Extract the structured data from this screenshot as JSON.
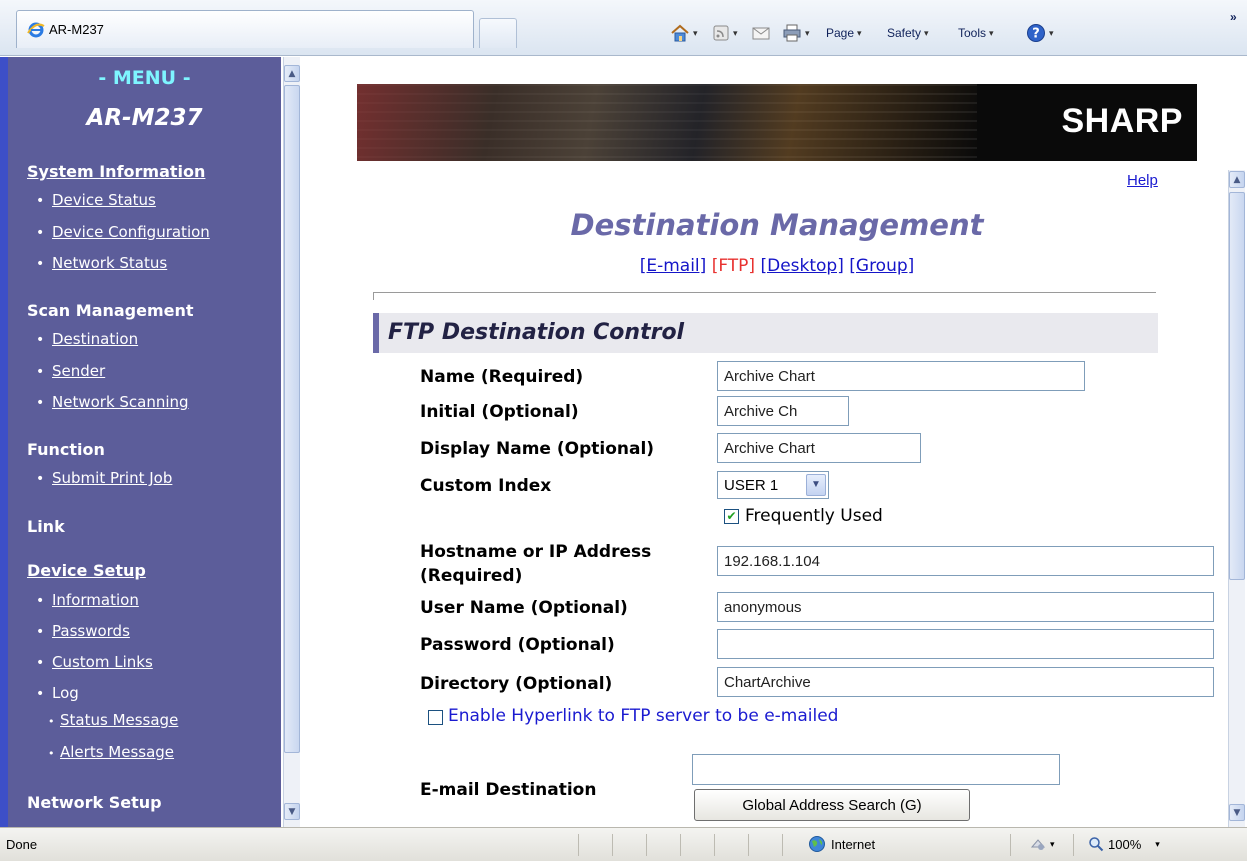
{
  "browser": {
    "tab_title": "AR-M237",
    "commands": {
      "page": "Page",
      "safety": "Safety",
      "tools": "Tools",
      "overflow": "»"
    }
  },
  "menu": {
    "title": "- MENU -",
    "model": "AR-M237",
    "system_information": {
      "heading": "System Information",
      "items": [
        "Device Status",
        "Device Configuration",
        "Network Status"
      ]
    },
    "scan_management": {
      "heading": "Scan Management",
      "items": [
        "Destination",
        "Sender",
        "Network Scanning"
      ]
    },
    "function": {
      "heading": "Function",
      "items": [
        "Submit Print Job"
      ]
    },
    "link_heading": "Link",
    "device_setup": {
      "heading": "Device Setup",
      "items": [
        "Information",
        "Passwords",
        "Custom Links",
        "Log"
      ],
      "log_items": [
        "Status Message",
        "Alerts Message"
      ]
    },
    "network_setup_heading": "Network Setup"
  },
  "banner": {
    "logo": "SHARP"
  },
  "page": {
    "help": "Help",
    "title": "Destination Management",
    "tabs": [
      "[E-mail]",
      "[FTP]",
      "[Desktop]",
      "[Group]"
    ],
    "current_tab": "[FTP]"
  },
  "form": {
    "section_title": "FTP Destination Control",
    "name": {
      "label": "Name (Required)",
      "value": "Archive Chart"
    },
    "initial": {
      "label": "Initial (Optional)",
      "value": "Archive Ch"
    },
    "display_name": {
      "label": "Display Name (Optional)",
      "value": "Archive Chart"
    },
    "custom_index": {
      "label": "Custom Index",
      "value": "USER 1"
    },
    "frequently_used": {
      "label": "Frequently Used",
      "checked": true
    },
    "hostname": {
      "label_line1": "Hostname or IP Address",
      "label_line2": "(Required)",
      "value": "192.168.1.104"
    },
    "user_name": {
      "label": "User Name (Optional)",
      "value": "anonymous"
    },
    "password": {
      "label": "Password (Optional)",
      "value": ""
    },
    "directory": {
      "label": "Directory (Optional)",
      "value": "ChartArchive"
    },
    "hyperlink": {
      "label": "Enable Hyperlink to FTP server to be e-mailed",
      "checked": false
    },
    "email_destination": {
      "label": "E-mail Destination",
      "value": ""
    },
    "global_search_button": "Global Address Search (G)"
  },
  "status_bar": {
    "text": "Done",
    "zone": "Internet",
    "zoom": "100%"
  }
}
